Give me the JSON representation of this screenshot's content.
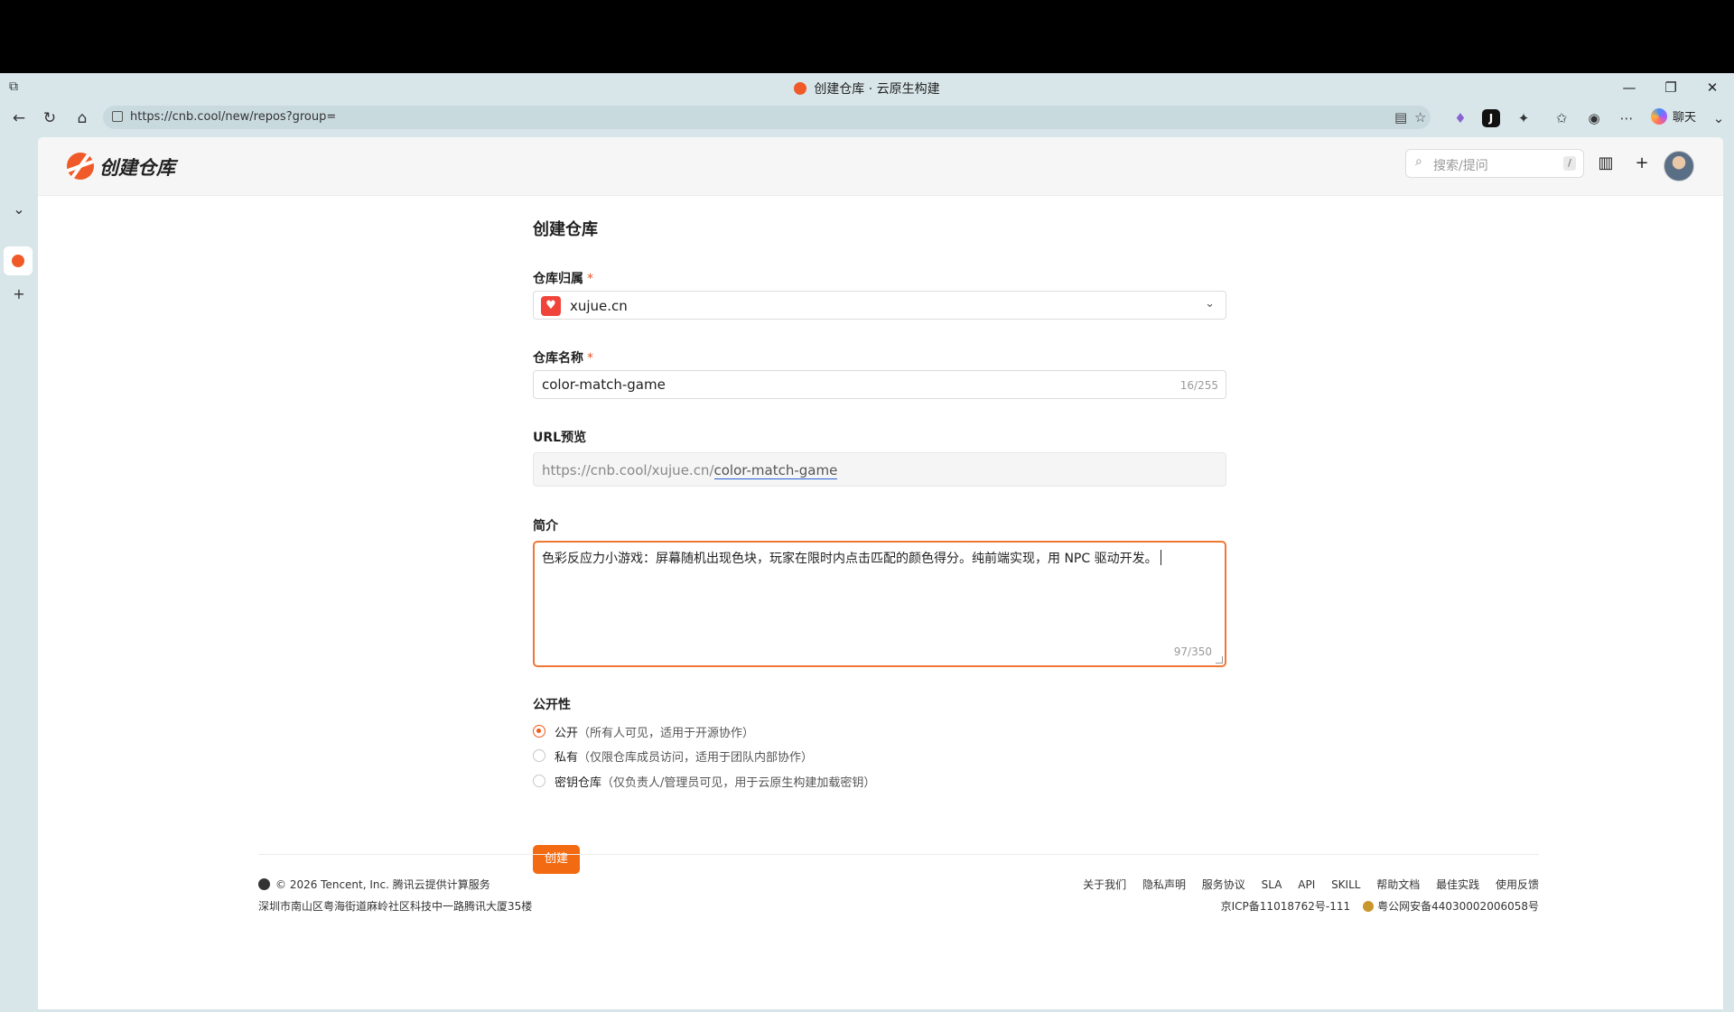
{
  "browser": {
    "tab_title": "创建仓库 · 云原生构建",
    "url": "https://cnb.cool/new/repos?group=",
    "chat_label": "聊天"
  },
  "header": {
    "app_title": "创建仓库",
    "search_placeholder": "搜索/提问",
    "search_shortcut": "/"
  },
  "form": {
    "title": "创建仓库",
    "owner_label": "仓库归属",
    "owner_value": "xujue.cn",
    "name_label": "仓库名称",
    "name_value": "color-match-game",
    "name_count": "16/255",
    "url_label": "URL预览",
    "url_base": "https://cnb.cool/xujue.cn/",
    "url_slug": "color-match-game",
    "desc_label": "简介",
    "desc_value": "色彩反应力小游戏：屏幕随机出现色块，玩家在限时内点击匹配的颜色得分。纯前端实现，用 NPC 驱动开发。",
    "desc_count": "97/350",
    "visibility_label": "公开性",
    "visibility_options": [
      {
        "name": "公开",
        "desc": "（所有人可见，适用于开源协作）",
        "checked": true
      },
      {
        "name": "私有",
        "desc": "（仅限仓库成员访问，适用于团队内部协作）",
        "checked": false
      },
      {
        "name": "密钥仓库",
        "desc": "（仅负责人/管理员可见，用于云原生构建加载密钥）",
        "checked": false
      }
    ],
    "required_mark": "*",
    "create_button": "创建"
  },
  "footer": {
    "copyright": "© 2026 Tencent, Inc. 腾讯云提供计算服务",
    "address": "深圳市南山区粤海街道麻岭社区科技中一路腾讯大厦35楼",
    "links": [
      "关于我们",
      "隐私声明",
      "服务协议",
      "SLA",
      "API",
      "SKILL",
      "帮助文档",
      "最佳实践",
      "使用反馈"
    ],
    "icp": "京ICP备11018762号-111",
    "police": "粤公网安备44030002006058号"
  },
  "colors": {
    "accent": "#f26a11",
    "focus_border": "#f07634"
  }
}
